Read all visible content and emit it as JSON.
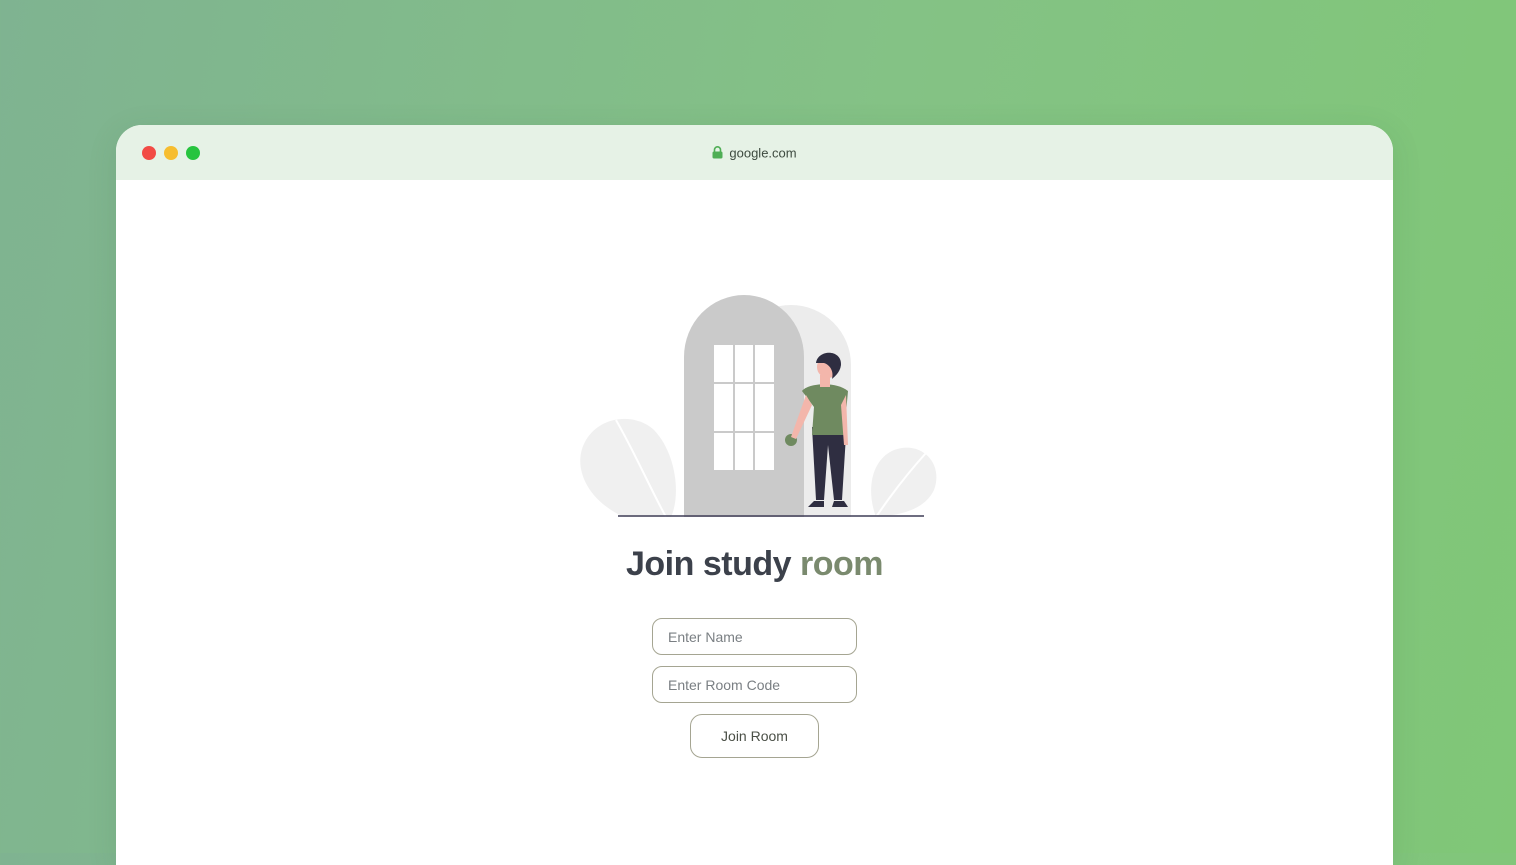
{
  "browser": {
    "url": "google.com",
    "controls": [
      "close",
      "minimize",
      "maximize"
    ],
    "control_colors": {
      "close": "#f24b45",
      "minimize": "#f6bd2f",
      "maximize": "#27c43f"
    },
    "lock_icon": "lock-icon"
  },
  "illustration": {
    "icon": "door-person-illustration"
  },
  "heading": {
    "main": "Join study",
    "accent": "room"
  },
  "form": {
    "name_placeholder": "Enter Name",
    "name_value": "",
    "room_code_placeholder": "Enter Room Code",
    "room_code_value": "",
    "join_label": "Join Room"
  },
  "colors": {
    "heading": "#3c414b",
    "accent": "#7a8a6e",
    "field_border": "#a5a592",
    "titlebar": "#e6f2e6"
  }
}
